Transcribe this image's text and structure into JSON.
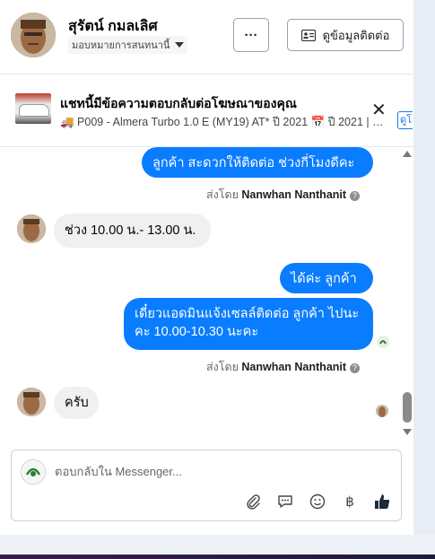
{
  "header": {
    "name": "สุรัตน์ กมลเลิศ",
    "assign_label": "มอบหมายการสนทนานี้",
    "more_label": "···",
    "contact_label": "ดูข้อมูลติดต่อ"
  },
  "ad": {
    "title": "แชทนี้มีข้อความตอบกลับต่อโฆษณาของคุณ",
    "subtitle": "🚚 P009 - Almera Turbo 1.0 E (MY19) AT* ปี 2021 📅 ปี 2021 | ⚙️ เ...",
    "close_label": "✕",
    "link_label": "ดูโ"
  },
  "messages": {
    "m1": "ลูกค้า สะดวกให้ติดต่อ ช่วงกี่โมงดีคะ",
    "sent_prefix": "ส่งโดย",
    "sender": "Nanwhan Nanthanit",
    "m2": "ช่วง 10.00 น.- 13.00 น.",
    "m3": "ได้ค่ะ  ลูกค้า",
    "m4": "เดี๋ยวแอดมินแจ้งเซลล์ติดต่อ ลูกค้า  ไปนะคะ  10.00-10.30 นะคะ",
    "m5": "ครับ"
  },
  "composer": {
    "placeholder": "ตอบกลับใน Messenger..."
  },
  "colors": {
    "outgoing": "#0a7cff",
    "incoming": "#f0f0f0",
    "accent": "#1877f2"
  }
}
